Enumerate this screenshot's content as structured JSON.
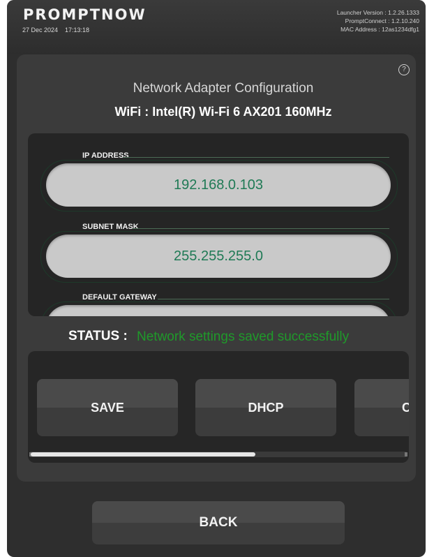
{
  "header": {
    "brand": "PROMPTNOW",
    "date": "27 Dec 2024",
    "time": "17:13:18",
    "launcher_version": "Launcher Version : 1.2.26.1333",
    "promptconnect_version": "PromptConnect : 1.2.10.240",
    "mac_address": "MAC Address : 12as1234dfg1"
  },
  "panel": {
    "help_icon": "question-circle-icon",
    "help_glyph": "?",
    "title": "Network Adapter Configuration",
    "adapter": "WiFi : Intel(R) Wi-Fi 6 AX201 160MHz"
  },
  "fields": [
    {
      "label": "IP ADDRESS",
      "value": "192.168.0.103"
    },
    {
      "label": "SUBNET MASK",
      "value": "255.255.255.0"
    },
    {
      "label": "DEFAULT GATEWAY",
      "value": ""
    }
  ],
  "status": {
    "label": "STATUS :",
    "message": "Network settings saved successfully",
    "color": "#1f9a2a"
  },
  "actions": {
    "save": "SAVE",
    "dhcp": "DHCP",
    "third": "C",
    "scroll_position": 0.6
  },
  "back_label": "BACK",
  "colors": {
    "background": "#2e2e2e",
    "panel": "#3b3b3b",
    "input_fill": "#c9c9c9",
    "input_text": "#1f7a55",
    "status_success": "#1f9a2a"
  }
}
